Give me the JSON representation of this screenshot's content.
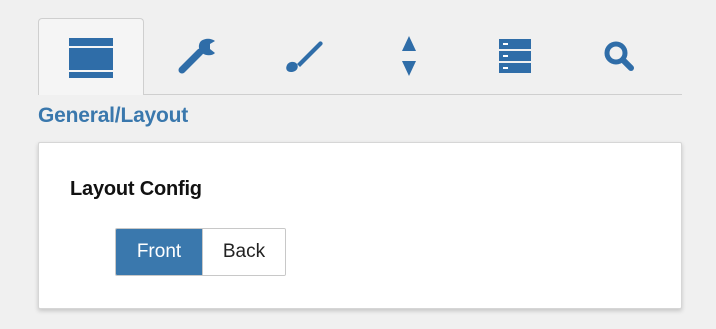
{
  "theme": {
    "accent": "#3a78ad",
    "icon": "#2f6da8",
    "card_background": "#ffffff",
    "page_background": "#f0f0f0"
  },
  "tabs": [
    {
      "name": "general",
      "icon": "layout-icon",
      "active": true
    },
    {
      "name": "wrench",
      "icon": "wrench-icon",
      "active": false
    },
    {
      "name": "brush",
      "icon": "brush-icon",
      "active": false
    },
    {
      "name": "sort",
      "icon": "sort-arrows-icon",
      "active": false
    },
    {
      "name": "data",
      "icon": "database-icon",
      "active": false
    },
    {
      "name": "search",
      "icon": "search-icon",
      "active": false
    }
  ],
  "section": {
    "title": "General/Layout"
  },
  "card": {
    "title": "Layout Config",
    "options": {
      "front": "Front",
      "back": "Back",
      "selected": "Front"
    }
  }
}
